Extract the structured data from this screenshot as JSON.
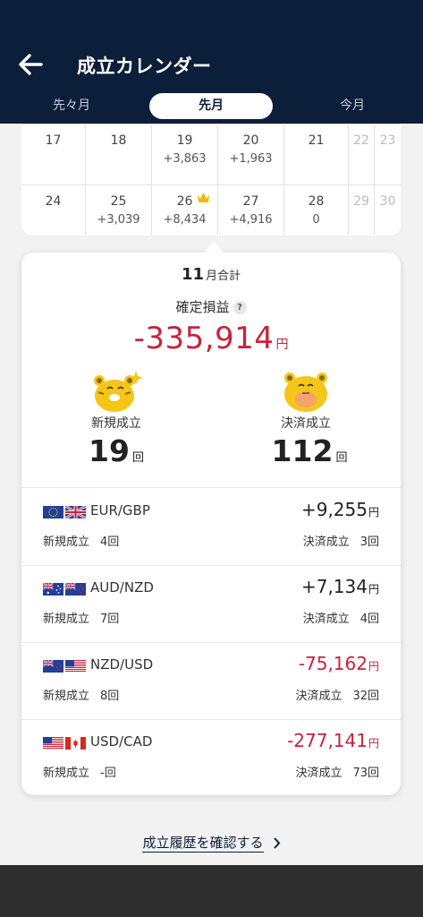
{
  "header": {
    "title": "成立カレンダー",
    "tabs": [
      "先々月",
      "先月",
      "今月"
    ],
    "active_tab": 1
  },
  "calendar": {
    "rows": [
      [
        {
          "day": "17",
          "value": ""
        },
        {
          "day": "18",
          "value": ""
        },
        {
          "day": "19",
          "value": "+3,863"
        },
        {
          "day": "20",
          "value": "+1,963"
        },
        {
          "day": "21",
          "value": ""
        },
        {
          "day": "22",
          "value": "",
          "muted": true
        },
        {
          "day": "23",
          "value": "",
          "muted": true
        }
      ],
      [
        {
          "day": "24",
          "value": ""
        },
        {
          "day": "25",
          "value": "+3,039"
        },
        {
          "day": "26",
          "value": "+8,434",
          "crown": true
        },
        {
          "day": "27",
          "value": "+4,916"
        },
        {
          "day": "28",
          "value": "0"
        },
        {
          "day": "29",
          "value": "",
          "muted": true
        },
        {
          "day": "30",
          "value": "",
          "muted": true
        }
      ]
    ]
  },
  "summary": {
    "month_num": "11",
    "month_suffix": "月合計",
    "pl_label": "確定損益",
    "help": "?",
    "pl_value": "-335,914",
    "pl_unit": "円",
    "new_label": "新規成立",
    "new_count": "19",
    "close_label": "決済成立",
    "close_count": "112",
    "count_unit": "回"
  },
  "pairs": [
    {
      "name": "EUR/GBP",
      "flags": [
        "eu",
        "gb"
      ],
      "pl": "+9,255",
      "sign": "pos",
      "new_label": "新規成立",
      "new": "4回",
      "close_label": "決済成立",
      "close": "3回"
    },
    {
      "name": "AUD/NZD",
      "flags": [
        "au",
        "nz"
      ],
      "pl": "+7,134",
      "sign": "pos",
      "new_label": "新規成立",
      "new": "7回",
      "close_label": "決済成立",
      "close": "4回"
    },
    {
      "name": "NZD/USD",
      "flags": [
        "nz",
        "us"
      ],
      "pl": "-75,162",
      "sign": "neg",
      "new_label": "新規成立",
      "new": "8回",
      "close_label": "決済成立",
      "close": "32回"
    },
    {
      "name": "USD/CAD",
      "flags": [
        "us",
        "ca"
      ],
      "pl": "-277,141",
      "sign": "neg",
      "new_label": "新規成立",
      "new": "-回",
      "close_label": "決済成立",
      "close": "73回"
    }
  ],
  "pair_unit": "円",
  "history_link": "成立履歴を確認する",
  "colors": {
    "navy": "#0b1f3a",
    "negative": "#c8233a",
    "mascot": "#f5c518"
  },
  "icons": {
    "back": "arrow-left-icon",
    "crown": "crown-icon",
    "chevron": "chevron-right-icon"
  }
}
